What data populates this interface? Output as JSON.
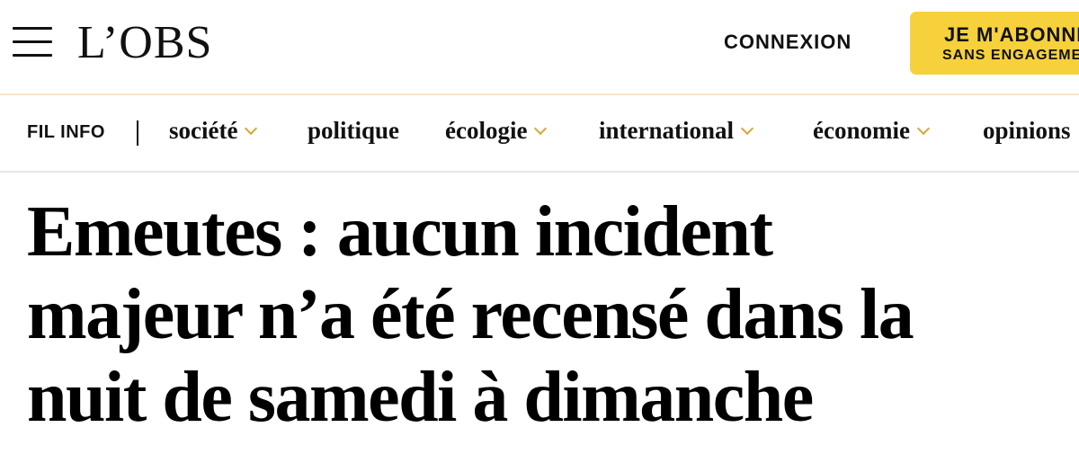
{
  "header": {
    "logo": "L’OBS",
    "login_label": "CONNEXION",
    "subscribe_line1": "JE M'ABONNE",
    "subscribe_line2": "SANS ENGAGEMENT"
  },
  "nav": {
    "fil_info": "FIL INFO",
    "items": [
      {
        "label": "société",
        "has_dropdown": true
      },
      {
        "label": "politique",
        "has_dropdown": false
      },
      {
        "label": "écologie",
        "has_dropdown": true
      },
      {
        "label": "international",
        "has_dropdown": true
      },
      {
        "label": "économie",
        "has_dropdown": true
      },
      {
        "label": "opinions",
        "has_dropdown": false
      }
    ]
  },
  "article": {
    "headline_lines": [
      "Emeutes : aucun incident",
      "majeur n’a été recensé dans la",
      "nuit de samedi à dimanche"
    ]
  },
  "colors": {
    "subscribe_bg": "#f6d13c",
    "chevron": "#d9a53a",
    "header_border": "#f3e6c7"
  }
}
